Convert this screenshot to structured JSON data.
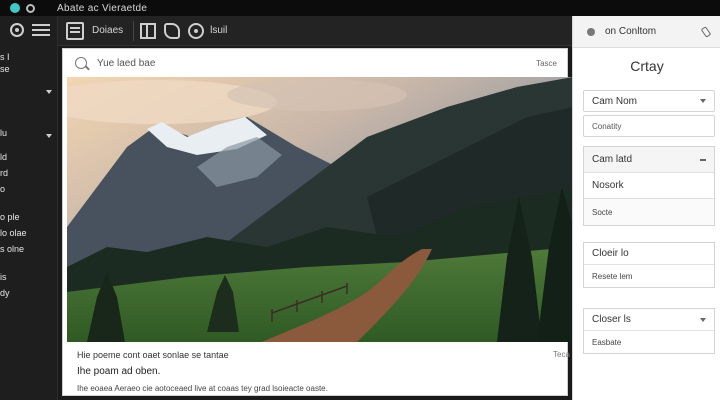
{
  "window": {
    "title": "Abate ac Vieraetde"
  },
  "sidebar": {
    "items": [
      {
        "label": "s I"
      },
      {
        "label": "se"
      },
      {
        "label": "lu"
      },
      {
        "label": "ld"
      },
      {
        "label": "rd"
      },
      {
        "label": "o"
      },
      {
        "label": "o ple"
      },
      {
        "label": "lo olae"
      },
      {
        "label": "s olne"
      },
      {
        "label": "is"
      },
      {
        "label": "dy"
      }
    ]
  },
  "toolbar": {
    "doc_label": "Doiaes",
    "title_label": "lsuil"
  },
  "content": {
    "search_placeholder": "Yue laed bae",
    "search_hint": "Tasce",
    "caption_line1": "Hie poeme cont oaet sonlae se tantae",
    "caption_line1_right": "Teca",
    "caption_line2": "Ihe poam ad oben.",
    "caption_line3": "Ihe eoaea Aeraeo cie aotoceaed live at coaas tey grad lsoieacte oaste."
  },
  "panel": {
    "header_title": "on Conltom",
    "heading": "Crtay",
    "field1": "Cam Nom",
    "field2": "Conatity",
    "dropdown": {
      "header": "Cam latd",
      "options": [
        "Nosork",
        "Socte"
      ]
    },
    "group1": {
      "title": "Cloeir lo",
      "sub": "Resete lem"
    },
    "group2": {
      "title": "Closer ls",
      "sub": "Easbate"
    }
  },
  "colors": {
    "accent": "#3ec9c5",
    "chrome_dark": "#1a1a1a",
    "panel_bg": "#ffffff"
  }
}
